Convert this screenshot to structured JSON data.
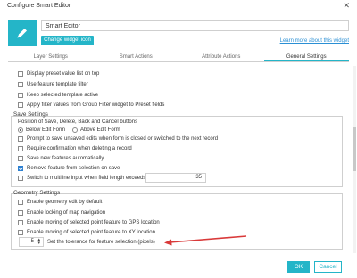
{
  "dialog": {
    "title": "Configure Smart Editor",
    "widget_name": "Smart Editor",
    "change_icon_label": "Change widget icon",
    "learn_more": "Learn more about this widget",
    "ok_label": "OK",
    "cancel_label": "Cancel",
    "accent_color": "#24b5c8"
  },
  "tabs": [
    {
      "label": "Layer Settings"
    },
    {
      "label": "Smart Actions"
    },
    {
      "label": "Attribute Actions"
    },
    {
      "label": "General Settings",
      "active": true
    }
  ],
  "general": {
    "items": [
      {
        "label": "Display preset value list on top",
        "checked": false
      },
      {
        "label": "Use feature template filter",
        "checked": false
      },
      {
        "label": "Keep selected template active",
        "checked": false
      },
      {
        "label": "Apply filter values from Group Filter widget to Preset fields",
        "checked": false
      }
    ]
  },
  "save_settings": {
    "title": "Save Settings",
    "position_label": "Position of Save, Delete, Back and Cancel buttons",
    "below_label": "Below Edit Form",
    "above_label": "Above Edit Form",
    "items": [
      {
        "label": "Prompt to save unsaved edits when form is closed or switched to the next record",
        "checked": false
      },
      {
        "label": "Require confirmation when deleting a record",
        "checked": false
      },
      {
        "label": "Save new features automatically",
        "checked": false
      },
      {
        "label": "Remove feature from selection on save",
        "checked": true
      },
      {
        "label": "Switch to multiline input when field length exceeds",
        "checked": false
      }
    ],
    "multiline_length": "35"
  },
  "geometry_settings": {
    "title": "Geometry Settings",
    "items": [
      {
        "label": "Enable geometry edit by default",
        "checked": false
      },
      {
        "label": "Enable locking of map navigation",
        "checked": false
      },
      {
        "label": "Enable moving of selected point feature to GPS location",
        "checked": false
      },
      {
        "label": "Enable moving of selected point feature to XY location",
        "checked": false
      }
    ],
    "tolerance_value": "5",
    "tolerance_label": "Set the tolerance for feature selection (pixels)"
  }
}
